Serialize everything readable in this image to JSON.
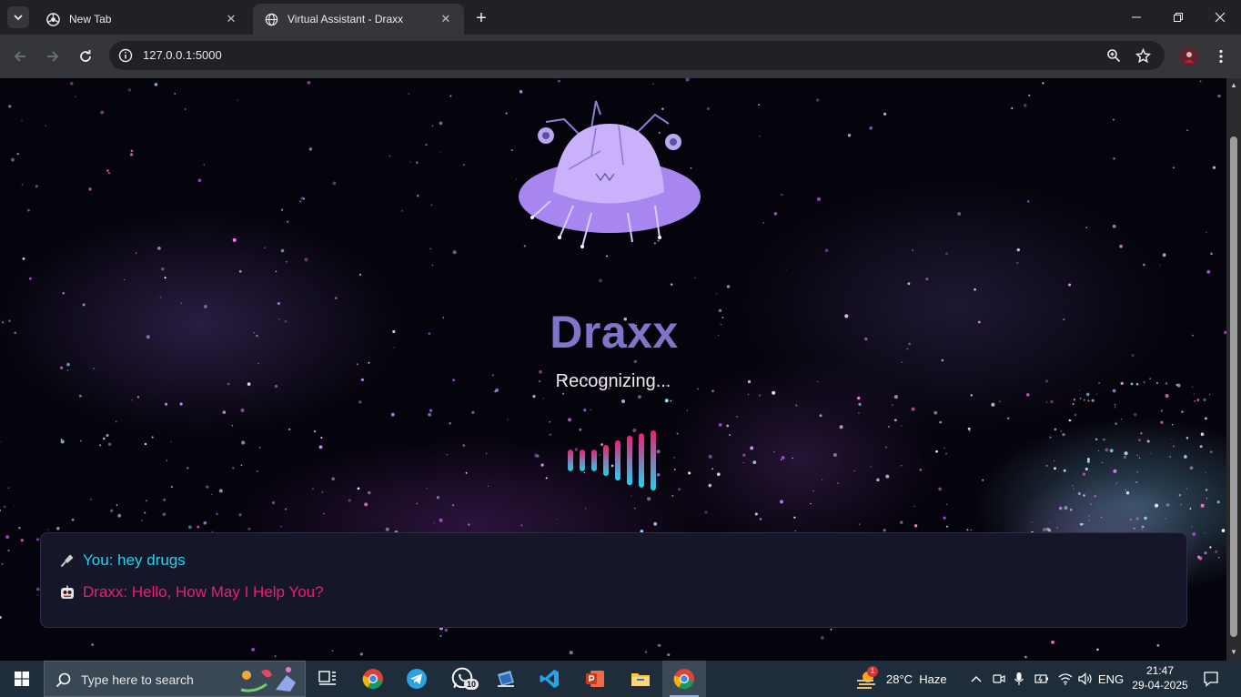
{
  "browser": {
    "tabs": [
      {
        "title": "New Tab",
        "active": false
      },
      {
        "title": "Virtual Assistant - Draxx",
        "active": true
      }
    ],
    "url": "127.0.0.1:5000"
  },
  "page": {
    "app_name": "Draxx",
    "status": "Recognizing...",
    "waveform": {
      "bar_levels": [
        0.35,
        0.35,
        0.35,
        0.5,
        0.65,
        0.8,
        0.88,
        0.97
      ],
      "colors": [
        "#ec1f73",
        "#22d3ee"
      ]
    },
    "chat": [
      {
        "icon": "microphone-icon",
        "text": "You: hey drugs",
        "color": "#22d3ee"
      },
      {
        "icon": "robot-icon",
        "text": "Draxx: Hello, How May I Help You?",
        "color": "#ec1f73"
      }
    ],
    "title_color": "#7f76c9"
  },
  "taskbar": {
    "search_placeholder": "Type here to search",
    "apps": [
      "task-view",
      "chrome",
      "telegram",
      "whatsapp",
      "vm-app",
      "vscode",
      "powerpoint",
      "file-explorer",
      "chrome-active"
    ],
    "whatsapp_badge": "10",
    "weather_badge": "1",
    "weather": "28°C  Haze",
    "language": "ENG",
    "time": "21:47",
    "date": "29-04-2025"
  }
}
